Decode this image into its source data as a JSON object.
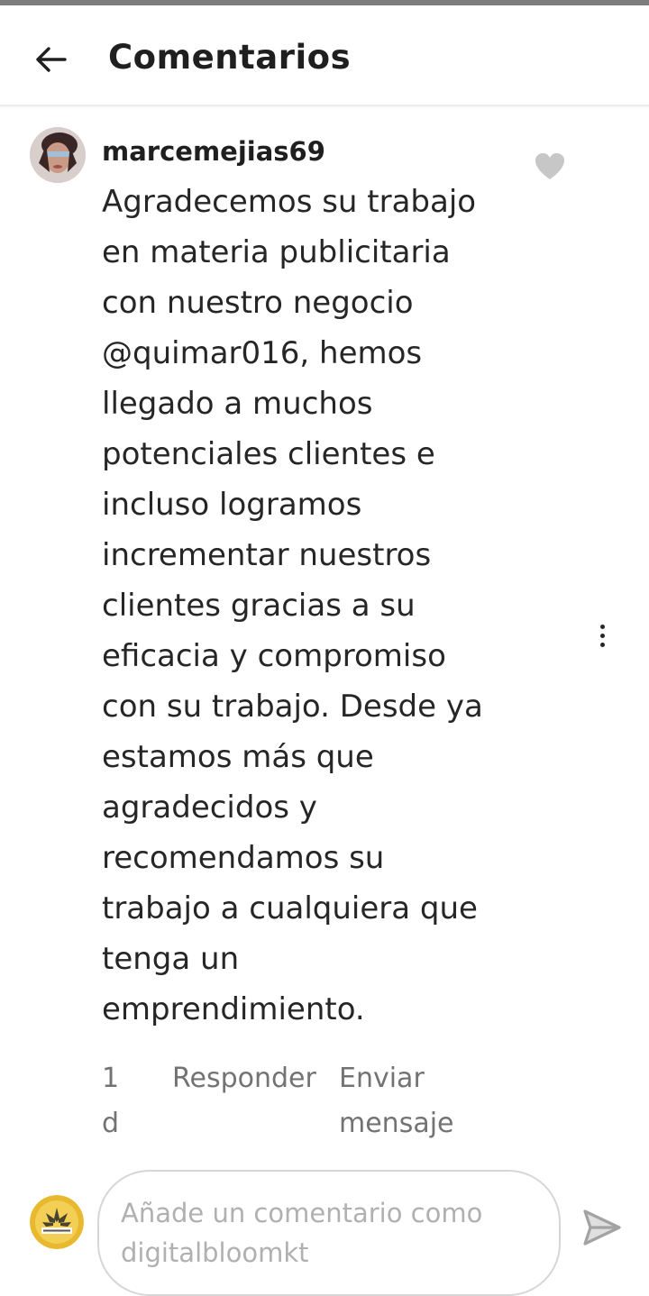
{
  "header": {
    "title": "Comentarios",
    "back_icon": "arrow-left-icon"
  },
  "comment": {
    "username": "marcemejias69",
    "text": "Agradecemos su trabajo\nen materia publicitaria\ncon nuestro negocio\n@quimar016, hemos\nllegado a muchos\npotenciales clientes e\nincluso logramos\nincrementar nuestros\nclientes gracias a su\neficacia y compromiso\ncon su trabajo. Desde ya\nestamos más que\nagradecidos y\nrecomendamos su\ntrabajo a cualquiera que\ntenga un\nemprendimiento.",
    "time": "1d",
    "reply_label": "Responder",
    "send_message_label": "Enviar mensaje",
    "like_icon": "heart-icon",
    "more_icon": "more-vertical-icon"
  },
  "composer": {
    "placeholder": "Añade un comentario como digitalbloomkt",
    "send_icon": "send-icon"
  },
  "colors": {
    "text_primary": "#262626",
    "text_secondary": "#737373",
    "placeholder": "#b0b0b0",
    "border": "#d6d6d6",
    "icon_gray": "#c7c7c7"
  }
}
